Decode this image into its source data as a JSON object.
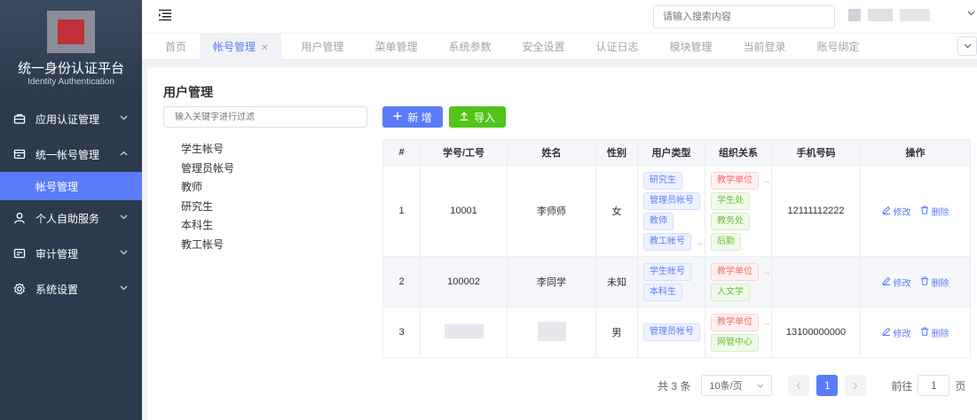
{
  "brand": {
    "title": "统一身份认证平台",
    "subtitle": "Identity Authentication"
  },
  "sidebar": {
    "items": [
      {
        "label": "应用认证管理",
        "icon": "app-auth-icon"
      },
      {
        "label": "统一帐号管理",
        "icon": "account-card-icon"
      },
      {
        "label": "帐号管理"
      },
      {
        "label": "个人自助服务",
        "icon": "user-icon"
      },
      {
        "label": "审计管理",
        "icon": "audit-icon"
      },
      {
        "label": "系统设置",
        "icon": "settings-gear-icon"
      }
    ]
  },
  "topbar": {
    "search_placeholder": "请输入搜索内容"
  },
  "tabs": [
    {
      "label": "首页"
    },
    {
      "label": "帐号管理",
      "active": true
    },
    {
      "label": "用户管理"
    },
    {
      "label": "菜单管理"
    },
    {
      "label": "系统参数"
    },
    {
      "label": "安全设置"
    },
    {
      "label": "认证日志"
    },
    {
      "label": "模块管理"
    },
    {
      "label": "当前登录"
    },
    {
      "label": "账号绑定"
    }
  ],
  "page": {
    "title": "用户管理",
    "filter_placeholder": "输入关键字进行过滤",
    "tree": [
      "学生帐号",
      "管理员帐号",
      "教师",
      "研究生",
      "本科生",
      "教工帐号"
    ],
    "add_label": "新 增",
    "import_label": "导入"
  },
  "table": {
    "headers": [
      "#",
      "学号/工号",
      "姓名",
      "性别",
      "用户类型",
      "组织关系",
      "手机号码",
      "操作"
    ],
    "rows": [
      {
        "index": "1",
        "id": "10001",
        "name": "李师师",
        "gender": "女",
        "user_types": [
          "研究生",
          "管理员帐号",
          "教师",
          "教工帐号"
        ],
        "orgs": [
          "教学单位",
          "学生处",
          "教务处",
          "后勤"
        ],
        "phone": "12111112222"
      },
      {
        "index": "2",
        "id": "100002",
        "name": "李同学",
        "gender": "未知",
        "user_types": [
          "学生帐号",
          "本科生"
        ],
        "orgs": [
          "教学单位",
          "人文学"
        ],
        "phone": ""
      },
      {
        "index": "3",
        "id": "",
        "name": "",
        "gender": "男",
        "user_types": [
          "管理员帐号"
        ],
        "orgs": [
          "教学单位",
          "网管中心"
        ],
        "phone": "13100000000"
      }
    ],
    "edit_label": "修改",
    "delete_label": "删除",
    "ellipsis": ".."
  },
  "pager": {
    "total": "共 3 条",
    "size": "10条/页",
    "current": "1",
    "goto_prefix": "前往",
    "goto_value": "1",
    "goto_suffix": "页"
  }
}
